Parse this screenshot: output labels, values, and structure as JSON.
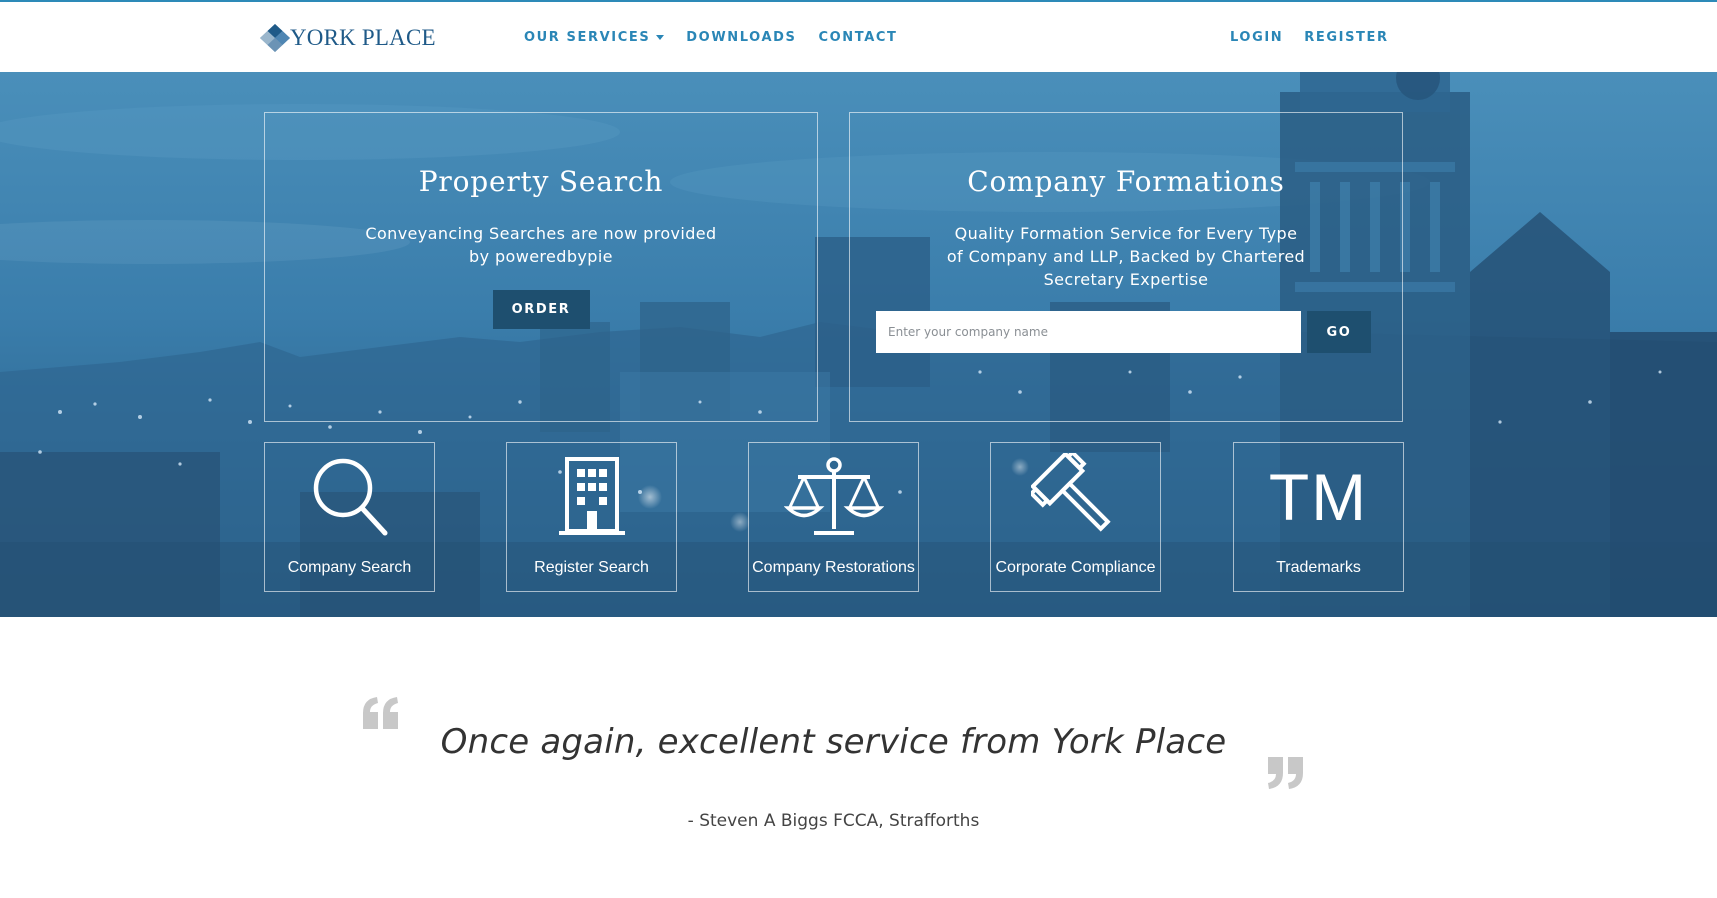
{
  "brand": {
    "name": "YORK PLACE"
  },
  "nav": {
    "main": [
      {
        "label": "OUR SERVICES",
        "has_dropdown": true
      },
      {
        "label": "DOWNLOADS",
        "has_dropdown": false
      },
      {
        "label": "CONTACT",
        "has_dropdown": false
      }
    ],
    "right": [
      {
        "label": "LOGIN"
      },
      {
        "label": "REGISTER"
      }
    ]
  },
  "property": {
    "title": "Property Search",
    "text": "Conveyancing Searches are now provided by poweredbypie",
    "button": "ORDER"
  },
  "company": {
    "title": "Company Formations",
    "text": "Quality Formation Service for Every Type of Company and LLP, Backed by Chartered Secretary Expertise",
    "placeholder": "Enter your company name",
    "button": "GO"
  },
  "services": [
    {
      "label": "Company Search",
      "icon": "magnifier-icon"
    },
    {
      "label": "Register Search",
      "icon": "building-icon"
    },
    {
      "label": "Company Restorations",
      "icon": "scales-icon"
    },
    {
      "label": "Corporate Compliance",
      "icon": "gavel-icon"
    },
    {
      "label": "Trademarks",
      "icon": "trademark-icon",
      "icon_text": "TM"
    }
  ],
  "testimonial": {
    "quote": "Once again, excellent service from York Place",
    "author": "- Steven A Biggs FCCA, Strafforths"
  },
  "colors": {
    "accent": "#2a86b6",
    "brand": "#1f5a88",
    "button": "#1e4f6f",
    "hero": "#3a7fae",
    "quote_mark": "#c8c8c8"
  }
}
